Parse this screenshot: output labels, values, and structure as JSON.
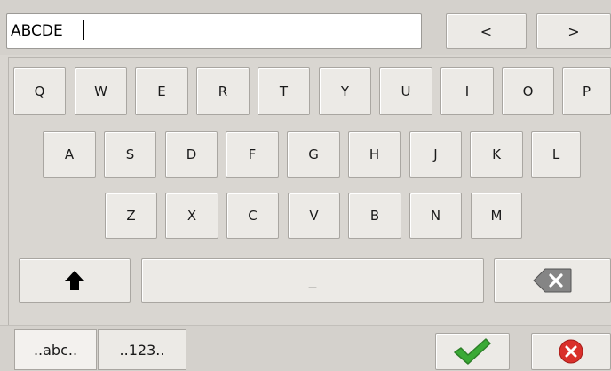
{
  "input": {
    "value": "ABCDE"
  },
  "nav": {
    "prev_label": "<",
    "next_label": ">"
  },
  "rows": [
    [
      "Q",
      "W",
      "E",
      "R",
      "T",
      "Y",
      "U",
      "I",
      "O",
      "P"
    ],
    [
      "A",
      "S",
      "D",
      "F",
      "G",
      "H",
      "J",
      "K",
      "L"
    ],
    [
      "Z",
      "X",
      "C",
      "V",
      "B",
      "N",
      "M"
    ]
  ],
  "space_label": "_",
  "tabs": {
    "letters": "..abc..",
    "numbers": "..123.."
  },
  "icons": {
    "shift": "shift-arrow-icon",
    "backspace": "backspace-icon",
    "confirm": "checkmark-icon",
    "cancel": "cancel-icon"
  },
  "colors": {
    "background": "#d9d6d1",
    "key": "#eceae6",
    "confirm": "#3aaa35",
    "cancel": "#d9302b"
  }
}
